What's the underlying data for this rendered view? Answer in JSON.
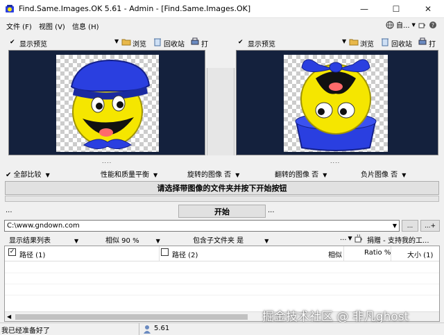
{
  "window": {
    "title": "Find.Same.Images.OK 5.61 - Admin - [Find.Same.Images.OK]",
    "minimize": "—",
    "maximize": "☐",
    "close": "✕"
  },
  "menu": {
    "items": [
      "文件 (F)",
      "视图 (V)",
      "信息 (H)"
    ],
    "right_label": "自..."
  },
  "left_pane": {
    "checkmark": "✔",
    "preview_label": "显示预览",
    "arrow": "▼",
    "browse": "浏览",
    "recycle": "回收站",
    "print": "打"
  },
  "right_pane": {
    "checkmark": "✔",
    "preview_label": "显示预览",
    "arrow": "▼",
    "browse": "浏览",
    "recycle": "回收站",
    "print": "打"
  },
  "dots": "....",
  "options": {
    "full_compare": "✔ 全部比较",
    "performance": "性能和质量平衡",
    "rotated": "旋转的图像  否",
    "flipped": "翻转的图像  否",
    "negative": "负片图像  否"
  },
  "status_message": "请选择带图像的文件夹并按下开始按钮",
  "progress": 0,
  "start_button": "开始",
  "left_dots": "...",
  "right_dots": "...",
  "path": "C:\\www.gndown.com",
  "browse_button": "...",
  "add_button": "...+",
  "options2": {
    "show_results": "显示结果列表",
    "similarity": "相似  90 %",
    "subfolders": "包含子文件夹  是",
    "donate_prefix": "...",
    "donate": "捐赠 - 支持我的工..."
  },
  "results": {
    "col_path1": "路径 (1)",
    "col_path2": "路径 (2)",
    "col_similar": "相似",
    "col_ratio": "Ratio %",
    "col_size": "大小 (1)"
  },
  "statusbar": {
    "ready": "我已经准备好了",
    "version": "5.61"
  },
  "watermark": "掘金技术社区 @ 非凡ghost",
  "colors": {
    "preview_bg": "#14213d",
    "face": "#f5e600",
    "hat": "#2a3fe0"
  }
}
